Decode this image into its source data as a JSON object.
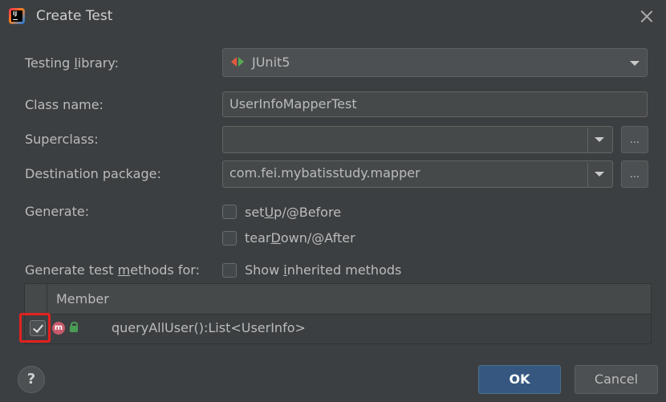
{
  "dialog": {
    "title": "Create Test"
  },
  "fields": {
    "testing_library": {
      "label_pre": "Testing ",
      "label_u": "l",
      "label_post": "ibrary:",
      "value": "JUnit5"
    },
    "class_name": {
      "label": "Class name:",
      "value": "UserInfoMapperTest"
    },
    "superclass": {
      "label": "Superclass:",
      "value": ""
    },
    "destination_package": {
      "label": "Destination package:",
      "value": "com.fei.mybatisstudy.mapper"
    },
    "browse": "..."
  },
  "generate": {
    "label": "Generate:",
    "setup": {
      "pre": "set",
      "u": "U",
      "post": "p/@Before"
    },
    "teardown": {
      "pre": "tear",
      "u": "D",
      "post": "own/@After"
    }
  },
  "methods": {
    "label_pre": "Generate test ",
    "label_u": "m",
    "label_post": "ethods for:",
    "inherited_pre": "Show ",
    "inherited_u": "i",
    "inherited_post": "nherited methods",
    "column": "Member",
    "rows": [
      {
        "checked": true,
        "icon": "m",
        "text": "queryAllUser():List<UserInfo>"
      }
    ]
  },
  "buttons": {
    "help": "?",
    "ok": "OK",
    "cancel": "Cancel"
  },
  "colors": {
    "accent": "#365880",
    "highlight": "#e3211f",
    "background": "#3c3f41"
  }
}
